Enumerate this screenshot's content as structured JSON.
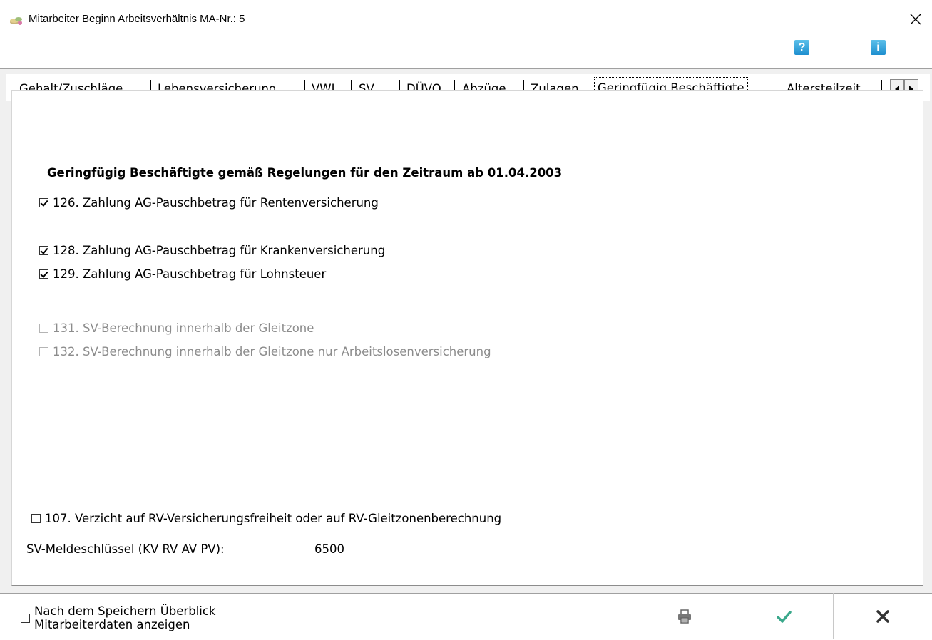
{
  "window": {
    "title": "Mitarbeiter Beginn Arbeitsverhältnis MA-Nr.: 5"
  },
  "help": {
    "help_label": "?",
    "info_label": "i"
  },
  "tabs": [
    {
      "pre": "",
      "u": "G",
      "post": "ehalt/Zuschläge"
    },
    {
      "pre": "Lebensversicheru",
      "u": "n",
      "post": "g"
    },
    {
      "pre": "",
      "u": "V",
      "post": "WL"
    },
    {
      "pre": "",
      "u": "S",
      "post": "V"
    },
    {
      "pre": "DÜV",
      "u": "O",
      "post": ""
    },
    {
      "pre": "A",
      "u": "b",
      "post": "züge"
    },
    {
      "pre": "",
      "u": "Z",
      "post": "ulagen"
    },
    {
      "pre": "G",
      "u": "e",
      "post": "ringfügig Beschäftigte"
    },
    {
      "pre": "Alters",
      "u": "t",
      "post": "eilzeit"
    }
  ],
  "active_tab_index": 7,
  "panel": {
    "heading": "Geringfügig Beschäftigte gemäß Regelungen für den Zeitraum ab 01.04.2003",
    "options": [
      {
        "label": "126. Zahlung AG-Pauschbetrag für Rentenversicherung",
        "checked": true,
        "enabled": true
      },
      {
        "label": "128. Zahlung AG-Pauschbetrag für Krankenversicherung",
        "checked": true,
        "enabled": true
      },
      {
        "label": "129. Zahlung AG-Pauschbetrag für Lohnsteuer",
        "checked": true,
        "enabled": true
      },
      {
        "label": "131. SV-Berechnung innerhalb der Gleitzone",
        "checked": false,
        "enabled": false
      },
      {
        "label": "132. SV-Berechnung innerhalb der Gleitzone nur Arbeitslosenversicherung",
        "checked": false,
        "enabled": false
      }
    ],
    "verzicht": {
      "label": "107. Verzicht auf RV-Versicherungsfreiheit oder auf RV-Gleitzonenberechnung",
      "checked": false
    },
    "sv_label": "SV-Meldeschlüssel (KV RV AV PV):",
    "sv_value": "6500"
  },
  "bottom": {
    "overview_line1": "Nach dem Speichern Überblick",
    "overview_line2": "Mitarbeiterdaten anzeigen",
    "overview_checked": false
  },
  "colors": {
    "accent_blue": "#1e8fcf",
    "check_green": "#3aa88b",
    "disabled_text": "#8c8c8c"
  }
}
